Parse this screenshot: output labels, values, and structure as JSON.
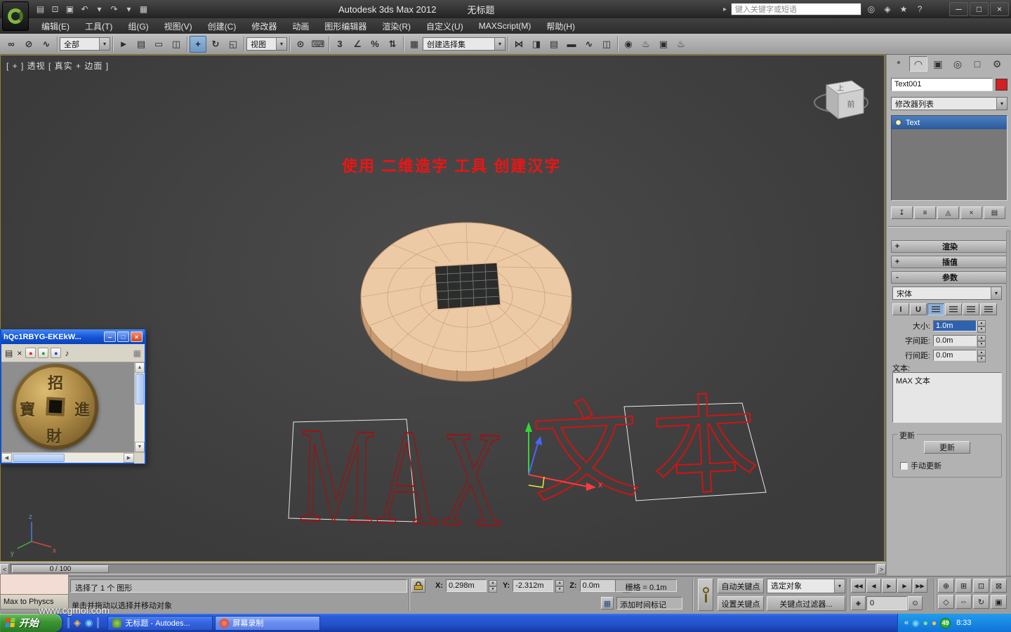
{
  "titlebar": {
    "app_title": "Autodesk 3ds Max  2012",
    "doc_title": "无标题",
    "search_placeholder": "键入关键字或短语",
    "menu_arrow": "▸",
    "qat_icons": [
      {
        "name": "new-scene-icon",
        "glyph": "▤"
      },
      {
        "name": "open-file-icon",
        "glyph": "⊡"
      },
      {
        "name": "save-file-icon",
        "glyph": "▣"
      },
      {
        "name": "undo-icon",
        "glyph": "↶"
      },
      {
        "name": "undo-dropdown-icon",
        "glyph": "▾"
      },
      {
        "name": "redo-icon",
        "glyph": "↷"
      },
      {
        "name": "redo-dropdown-icon",
        "glyph": "▾"
      },
      {
        "name": "project-folder-icon",
        "glyph": "▦"
      }
    ],
    "infocenter_icons": [
      {
        "name": "search-binoculars-icon",
        "glyph": "◎"
      },
      {
        "name": "communication-center-icon",
        "glyph": "◈"
      },
      {
        "name": "favorites-icon",
        "glyph": "★"
      },
      {
        "name": "help-icon",
        "glyph": "?"
      }
    ],
    "window_buttons": [
      {
        "name": "minimize-button",
        "glyph": "─"
      },
      {
        "name": "maximize-button",
        "glyph": "□"
      },
      {
        "name": "close-button",
        "glyph": "×"
      }
    ]
  },
  "menubar": {
    "items": [
      "编辑(E)",
      "工具(T)",
      "组(G)",
      "视图(V)",
      "创建(C)",
      "修改器",
      "动画",
      "图形编辑器",
      "渲染(R)",
      "自定义(U)",
      "MAXScript(M)",
      "帮助(H)"
    ]
  },
  "toolbar": {
    "dropdown_arrow": "▾",
    "filter_dropdown": "全部",
    "view_dropdown": "视图",
    "selection_set_dropdown": "创建选择集",
    "groups": {
      "link": [
        {
          "name": "select-and-link-icon",
          "glyph": "∞"
        },
        {
          "name": "unlink-selection-icon",
          "glyph": "⊘"
        },
        {
          "name": "bind-to-space-warp-icon",
          "glyph": "∿"
        }
      ],
      "selection": [
        {
          "name": "select-object-icon",
          "glyph": "►"
        },
        {
          "name": "select-by-name-icon",
          "glyph": "▤"
        },
        {
          "name": "selection-region-icon",
          "glyph": "▭"
        },
        {
          "name": "window-crossing-icon",
          "glyph": "◫"
        }
      ],
      "transform": [
        {
          "name": "select-and-move-icon",
          "glyph": "+",
          "active": true
        },
        {
          "name": "select-and-rotate-icon",
          "glyph": "↻"
        },
        {
          "name": "select-and-scale-icon",
          "glyph": "◱"
        }
      ],
      "manipulate": [
        {
          "name": "select-and-manipulate-icon",
          "glyph": "⊙"
        },
        {
          "name": "keyboard-override-icon",
          "glyph": "⌨"
        }
      ],
      "snaps": [
        {
          "name": "snaps-toggle-icon",
          "glyph": "3"
        },
        {
          "name": "angle-snap-icon",
          "glyph": "∠"
        },
        {
          "name": "percent-snap-icon",
          "glyph": "%"
        },
        {
          "name": "spinner-snap-icon",
          "glyph": "⇅"
        }
      ],
      "sets": [
        {
          "name": "named-selection-sets-icon",
          "glyph": "▦"
        }
      ],
      "tools": [
        {
          "name": "mirror-icon",
          "glyph": "⋈"
        },
        {
          "name": "align-icon",
          "glyph": "◨"
        },
        {
          "name": "layer-manager-icon",
          "glyph": "▤"
        },
        {
          "name": "ribbon-toggle-icon",
          "glyph": "▬"
        },
        {
          "name": "curve-editor-icon",
          "glyph": "∿"
        },
        {
          "name": "schematic-view-icon",
          "glyph": "◫"
        }
      ],
      "render": [
        {
          "name": "material-editor-icon",
          "glyph": "◉"
        },
        {
          "name": "render-setup-icon",
          "glyph": "♨"
        },
        {
          "name": "rendered-frame-icon",
          "glyph": "▣"
        },
        {
          "name": "render-production-icon",
          "glyph": "♨"
        }
      ]
    }
  },
  "viewport": {
    "label": "[ + ] 透视 [ 真实 + 边面 ]",
    "annotation": "使用 二维造字 工具 创建汉字",
    "wire_text_latin": "MAX",
    "wire_text_cjk": "文本",
    "gizmo_x_label": "x",
    "axis_labels": {
      "x": "x",
      "y": "y",
      "z": "z"
    },
    "viewcube": {
      "top": "上",
      "front": "前"
    }
  },
  "player_window": {
    "title": "hQc1RBYG-EKEkW...",
    "toolbar_icons": [
      {
        "name": "playlist-icon",
        "glyph": "▤"
      },
      {
        "name": "close-clip-icon",
        "glyph": "×"
      }
    ],
    "record_dots": [
      {
        "name": "record-red-icon",
        "glyph": "●",
        "cls": "dot-red"
      },
      {
        "name": "record-green-icon",
        "glyph": "●",
        "cls": "dot-green"
      },
      {
        "name": "record-blue-icon",
        "glyph": "●",
        "cls": "dot-blue"
      }
    ],
    "audio_icon": "♪",
    "grid_icon": "▦",
    "window_buttons": [
      {
        "name": "minimize-button",
        "glyph": "‒"
      },
      {
        "name": "maximize-button",
        "glyph": "□"
      },
      {
        "name": "close-button",
        "glyph": "×",
        "cls": "btn-close"
      }
    ],
    "coin_chars": {
      "top": "招",
      "right": "進",
      "bottom": "財",
      "left": "寶"
    },
    "scroll_up": "▲",
    "scroll_down": "▼",
    "scroll_left": "◀",
    "scroll_right": "▶"
  },
  "command_panel": {
    "tabs": [
      {
        "name": "create-tab",
        "glyph": "*"
      },
      {
        "name": "modify-tab",
        "glyph": "◠",
        "active": true
      },
      {
        "name": "hierarchy-tab",
        "glyph": "▣"
      },
      {
        "name": "motion-tab",
        "glyph": "◎"
      },
      {
        "name": "display-tab",
        "glyph": "□"
      },
      {
        "name": "utilities-tab",
        "glyph": "⚙"
      }
    ],
    "object_name": "Text001",
    "modifier_list_label": "修改器列表",
    "stack_items": [
      {
        "label": "Text",
        "active": true
      }
    ],
    "stack_buttons": [
      {
        "name": "pin-stack-icon",
        "glyph": "↧"
      },
      {
        "name": "show-end-result-icon",
        "glyph": "≡"
      },
      {
        "name": "make-unique-icon",
        "glyph": "◬"
      },
      {
        "name": "remove-modifier-icon",
        "glyph": "×"
      },
      {
        "name": "configure-modifier-sets-icon",
        "glyph": "▤"
      }
    ],
    "rollouts": [
      {
        "state": "+",
        "label": "渲染"
      },
      {
        "state": "+",
        "label": "插值"
      },
      {
        "state": "-",
        "label": "参数"
      }
    ],
    "font_dropdown": "宋体",
    "style_buttons": [
      {
        "name": "italic-button",
        "glyph": "I"
      },
      {
        "name": "underline-button",
        "glyph": "U"
      },
      {
        "name": "align-left-button",
        "glyph": "",
        "active": true
      },
      {
        "name": "align-center-button",
        "glyph": ""
      },
      {
        "name": "align-right-button",
        "glyph": ""
      },
      {
        "name": "justify-button",
        "glyph": ""
      }
    ],
    "fields": [
      {
        "label": "大小:",
        "value": "1.0m"
      },
      {
        "label": "字间距:",
        "value": "0.0m"
      },
      {
        "label": "行间距:",
        "value": "0.0m"
      }
    ],
    "text_label": "文本:",
    "text_content": "MAX 文本",
    "update_group_label": "更新",
    "update_button": "更新",
    "manual_update_label": "手动更新"
  },
  "timeline": {
    "slider_value": "0 / 100",
    "left_arrow": "<",
    "right_arrow": ">"
  },
  "status_bar": {
    "selection_info": "选择了 1 个 图形",
    "prompt": "单击并拖动以选择并移动对象",
    "coords": [
      {
        "label": "X:",
        "value": "0.298m"
      },
      {
        "label": "Y:",
        "value": "-2.312m"
      },
      {
        "label": "Z:",
        "value": "0.0m"
      }
    ],
    "grid_info": "栅格 = 0.1m",
    "time_tag": "添加时间标记",
    "auto_key": "自动关键点",
    "set_key": "设置关键点",
    "selection_filter": "选定对象",
    "key_filters": "关键点过滤器...",
    "frame_value": "0",
    "key_mode_glyph": "◈",
    "time_config_glyph": "⊙",
    "window_icon_glyph": "▦",
    "playback_icons": [
      {
        "name": "go-to-start-button",
        "glyph": "◀◀"
      },
      {
        "name": "previous-frame-button",
        "glyph": "◀"
      },
      {
        "name": "play-button",
        "glyph": "▶"
      },
      {
        "name": "next-frame-button",
        "glyph": "▶"
      },
      {
        "name": "go-to-end-button",
        "glyph": "▶▶"
      }
    ],
    "nav_icons_row1": [
      {
        "name": "zoom-icon",
        "glyph": "⊕"
      },
      {
        "name": "zoom-all-icon",
        "glyph": "⊞"
      },
      {
        "name": "zoom-extents-icon",
        "glyph": "⊡"
      },
      {
        "name": "zoom-extents-all-icon",
        "glyph": "⊠"
      }
    ],
    "nav_icons_row2": [
      {
        "name": "field-of-view-icon",
        "glyph": "◇"
      },
      {
        "name": "pan-icon",
        "glyph": "⇔"
      },
      {
        "name": "orbit-icon",
        "glyph": "↻"
      },
      {
        "name": "maximize-viewport-icon",
        "glyph": "▣"
      }
    ]
  },
  "mini_window": {
    "title": "Max to Physcs"
  },
  "taskbar": {
    "start_label": "开始",
    "tasks": [
      {
        "name": "task-3dsmax",
        "label": "无标题 - Autodes..."
      },
      {
        "name": "task-screen-record",
        "label": "屏幕录制",
        "active": true
      }
    ],
    "tray_badge": "49",
    "clock": "8:33"
  },
  "watermark": "www.cgmol.com",
  "colors": {
    "annotation_red": "#ee1414",
    "wireframe_red": "#d01414",
    "selection_blue": "#2e62b0",
    "coin_face": "#edcaa6",
    "object_color_swatch": "#d42020",
    "taskbar_blue": "#2250c8",
    "start_green": "#3d9434"
  }
}
